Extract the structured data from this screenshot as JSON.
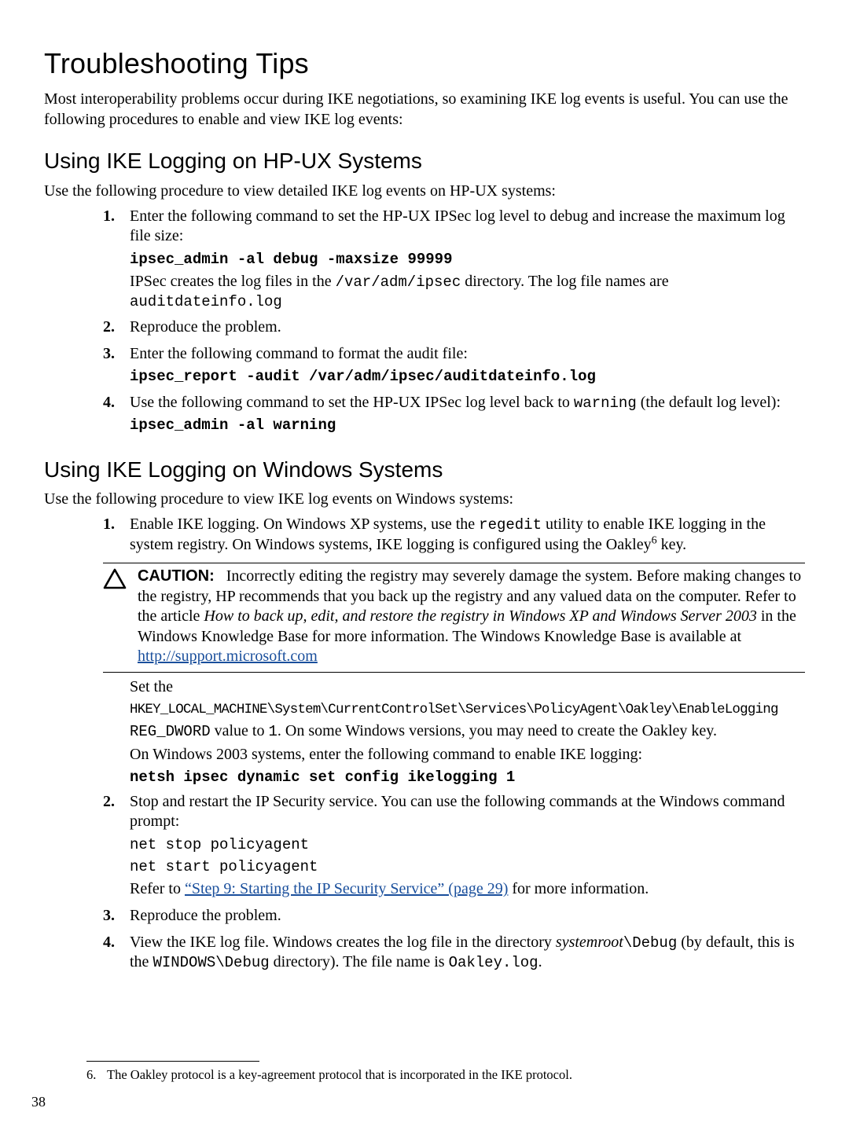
{
  "title": "Troubleshooting Tips",
  "intro": "Most interoperability problems occur during IKE negotiations, so examining IKE log events is useful. You can use the following procedures to enable and view IKE log events:",
  "hpux": {
    "heading": "Using IKE Logging on HP-UX Systems",
    "intro": "Use the following procedure to view detailed IKE log events on HP-UX systems:",
    "steps": [
      {
        "n": "1.",
        "text": "Enter the following command to set the HP-UX IPSec log level to debug and increase the maximum log file size:",
        "cmd": "ipsec_admin -al debug -maxsize 99999",
        "after_a": "IPSec creates the log files in the ",
        "path1": "/var/adm/ipsec",
        "after_b": " directory. The log file names are",
        "path2": "auditdateinfo.log"
      },
      {
        "n": "2.",
        "text": "Reproduce the problem."
      },
      {
        "n": "3.",
        "text": "Enter the following command to format the audit file:",
        "cmd": "ipsec_report -audit /var/adm/ipsec/auditdateinfo.log"
      },
      {
        "n": "4.",
        "before": "Use the following command to set the HP-UX IPSec log level back to ",
        "warn": "warning",
        "after": " (the default log level):",
        "cmd": "ipsec_admin -al warning"
      }
    ]
  },
  "win": {
    "heading": "Using IKE Logging on Windows Systems",
    "intro": "Use the following procedure to view IKE log events on Windows systems:",
    "step1": {
      "n": "1.",
      "a": "Enable IKE logging. On Windows XP systems, use the ",
      "regedit": "regedit",
      "b": " utility to enable IKE logging in the system registry. On Windows systems, IKE logging is configured using the Oakley",
      "fn": "6",
      "c": " key."
    },
    "caution": {
      "label": "CAUTION:",
      "a": "Incorrectly editing the registry may severely damage the system. Before making changes to the registry, HP recommends that you back up the registry and any valued data on the computer. Refer to the article ",
      "ital": "How to back up, edit, and restore the registry in Windows XP and Windows Server 2003",
      "b": " in the Windows Knowledge Base for more information. The Windows Knowledge Base is available at ",
      "url": "http://support.microsoft.com"
    },
    "after_caution": {
      "set": "Set the",
      "regpath": "HKEY_LOCAL_MACHINE\\System\\CurrentControlSet\\Services\\PolicyAgent\\Oakley\\EnableLogging",
      "dword": "REG_DWORD",
      "dword_b": " value to ",
      "one": "1",
      "dword_c": ". On some Windows versions, you may need to create the Oakley key.",
      "w2003": "On Windows 2003 systems, enter the following command to enable IKE logging:",
      "cmd": "netsh ipsec dynamic set config ikelogging 1"
    },
    "step2": {
      "n": "2.",
      "text": "Stop and restart the IP Security service. You can use the following commands at the Windows command prompt:",
      "c1": "net stop policyagent",
      "c2": "net start policyagent",
      "ref_a": "Refer to ",
      "ref_link": "“Step 9: Starting the IP Security Service” (page 29)",
      "ref_b": " for more information."
    },
    "step3": {
      "n": "3.",
      "text": "Reproduce the problem."
    },
    "step4": {
      "n": "4.",
      "a": "View the IKE log file. Windows creates the log file in the directory ",
      "sysroot": "systemroot",
      "debug1": "\\Debug",
      "b": " (by default, this is the ",
      "windebug": "WINDOWS\\Debug",
      "c": " directory). The file name is ",
      "oak": "Oakley.log",
      "d": "."
    }
  },
  "footnote": {
    "n": "6.",
    "text": "The Oakley protocol is a key-agreement protocol that is incorporated in the IKE protocol."
  },
  "page_number": "38"
}
